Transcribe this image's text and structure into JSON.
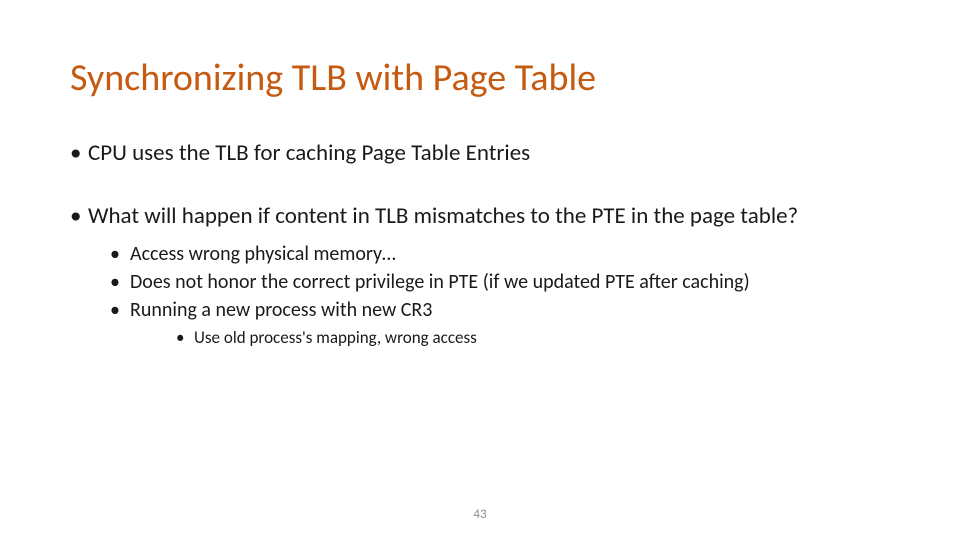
{
  "title": "Synchronizing TLB with Page Table",
  "bullets": {
    "b1": "CPU uses the TLB for caching Page Table Entries",
    "b2": "What will happen if content in TLB mismatches to the PTE in the page table?",
    "b2_sub": {
      "s1": "Access wrong physical memory…",
      "s2": "Does not honor the correct privilege in PTE (if we updated PTE after caching)",
      "s3": "Running a new process with new CR3",
      "s3_sub": {
        "t1": "Use old process's mapping, wrong access"
      }
    }
  },
  "page_number": "43",
  "colors": {
    "title": "#C55A11",
    "text": "#1a1a1a",
    "pagenum": "#8c8c8c"
  }
}
